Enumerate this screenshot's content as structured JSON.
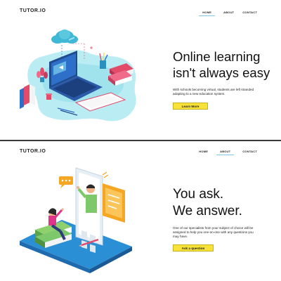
{
  "colors": {
    "accent_yellow": "#f7e23a",
    "nav_underline": "#7ecbe0",
    "divider": "#3a3a3a"
  },
  "sections": [
    {
      "logo": "TUTOR.IO",
      "nav": [
        "HOME",
        "ABOUT",
        "CONTACT"
      ],
      "active_nav": "HOME",
      "headline_line1": "Online learning",
      "headline_line2": "isn't always easy",
      "description": "With schools becoming virtual, students are left stranded adapting to a new education system.",
      "button": "Learn More",
      "illustration": "laptop-cloud-books-illustration"
    },
    {
      "logo": "TUTOR.IO",
      "nav": [
        "HOME",
        "ABOUT",
        "CONTACT"
      ],
      "active_nav": "ABOUT",
      "headline_line1": "You ask.",
      "headline_line2": "We answer.",
      "description": "One of our specialists from your subject of choice will be assigned to help you one-on-one with any questions you may have.",
      "button": "Ask a question",
      "illustration": "phone-tutor-student-illustration"
    }
  ]
}
